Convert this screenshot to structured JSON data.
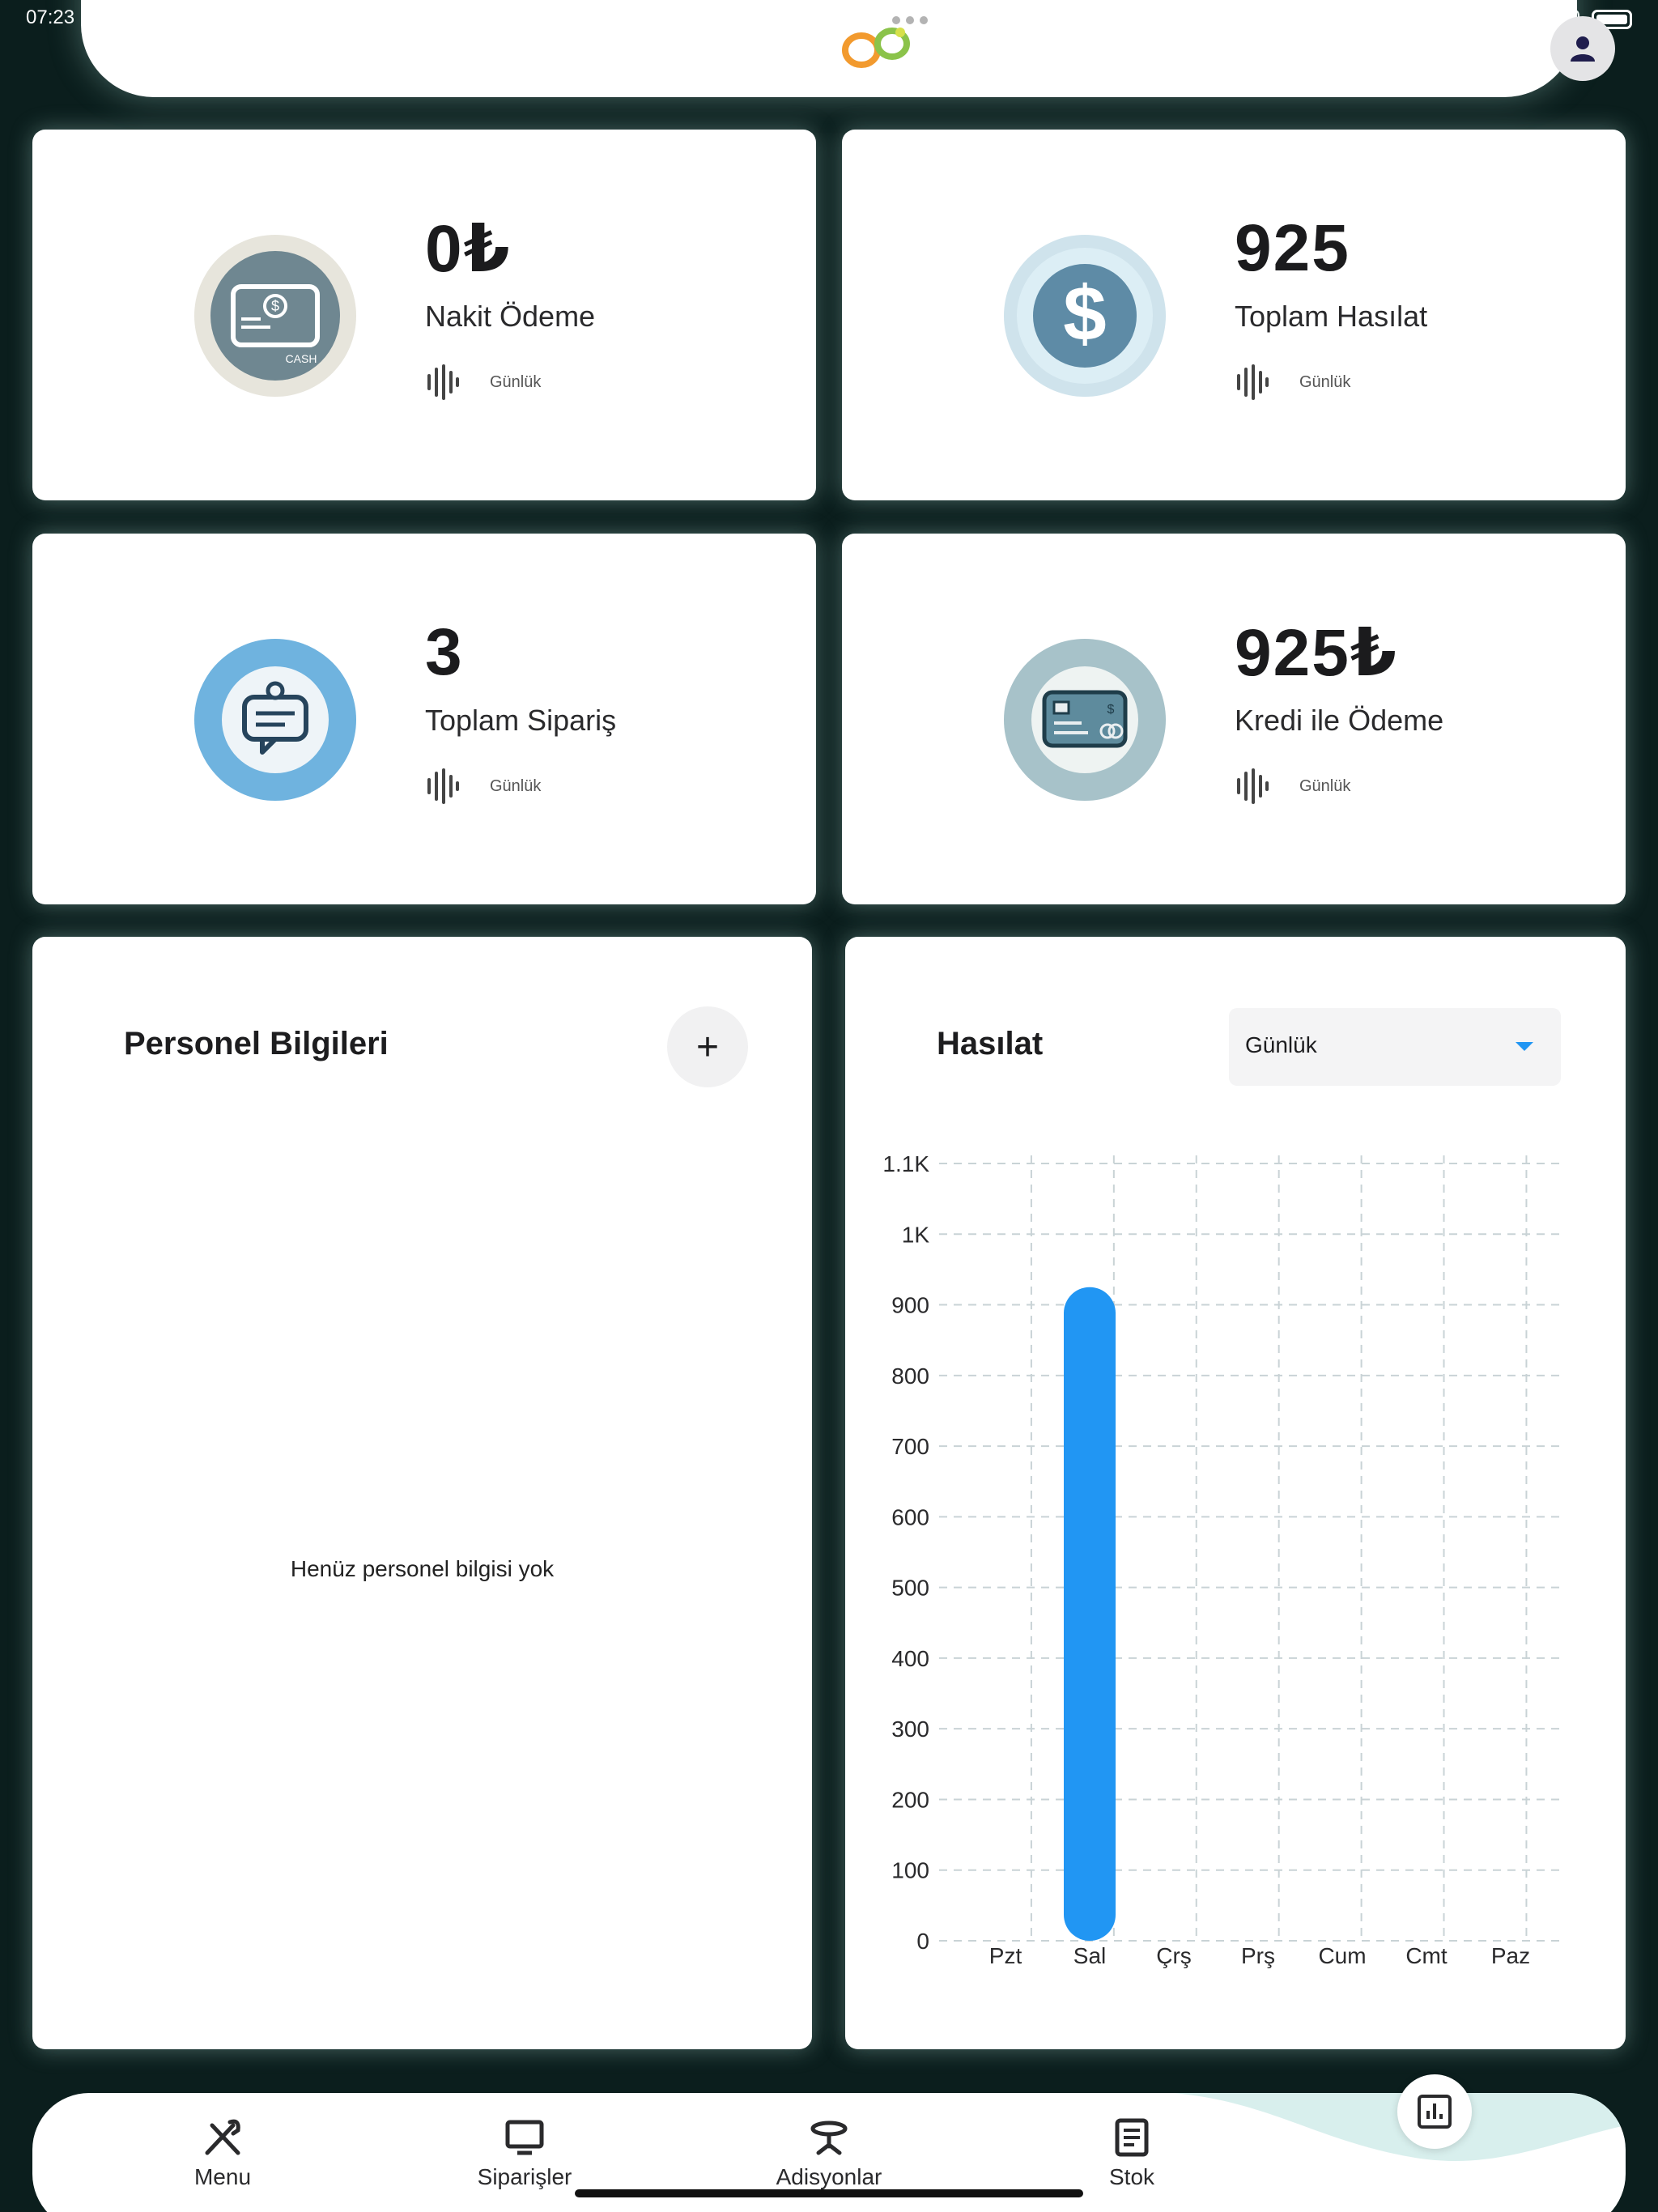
{
  "status_bar": {
    "time": "07:23",
    "partial_right": "0"
  },
  "stats": [
    {
      "value": "0₺",
      "label": "Nakit Ödeme",
      "period": "Günlük",
      "icon": "cash-card-icon"
    },
    {
      "value": "925",
      "label": "Toplam Hasılat",
      "period": "Günlük",
      "icon": "dollar-coin-icon"
    },
    {
      "value": "3",
      "label": "Toplam Sipariş",
      "period": "Günlük",
      "icon": "order-chat-icon"
    },
    {
      "value": "925₺",
      "label": "Kredi ile Ödeme",
      "period": "Günlük",
      "icon": "credit-card-icon"
    }
  ],
  "personnel": {
    "title": "Personel Bilgileri",
    "add_label": "+",
    "empty_text": "Henüz personel bilgisi yok"
  },
  "revenue": {
    "title": "Hasılat",
    "dropdown_value": "Günlük"
  },
  "chart_data": {
    "type": "bar",
    "categories": [
      "Pzt",
      "Sal",
      "Çrş",
      "Prş",
      "Cum",
      "Cmt",
      "Paz"
    ],
    "values": [
      0,
      925,
      0,
      0,
      0,
      0,
      0
    ],
    "ylim": [
      0,
      1100
    ],
    "yticks": [
      0,
      100,
      200,
      300,
      400,
      500,
      600,
      700,
      800,
      900,
      1000,
      1100
    ],
    "ytick_labels": [
      "0",
      "100",
      "200",
      "300",
      "400",
      "500",
      "600",
      "700",
      "800",
      "900",
      "1K",
      "1.1K"
    ],
    "title": "",
    "xlabel": "",
    "ylabel": "",
    "grid": true,
    "bar_color": "#2196f3"
  },
  "bottom_nav": {
    "items": [
      {
        "label": "Menu",
        "icon": "fork-knife-icon"
      },
      {
        "label": "Siparişler",
        "icon": "monitor-icon"
      },
      {
        "label": "Adisyonlar",
        "icon": "table-icon"
      },
      {
        "label": "Stok",
        "icon": "document-list-icon"
      }
    ],
    "fab_icon": "bar-chart-icon"
  },
  "colors": {
    "background": "#0b1e1d",
    "accent": "#2196f3",
    "nav_wave": "#d8efed"
  }
}
